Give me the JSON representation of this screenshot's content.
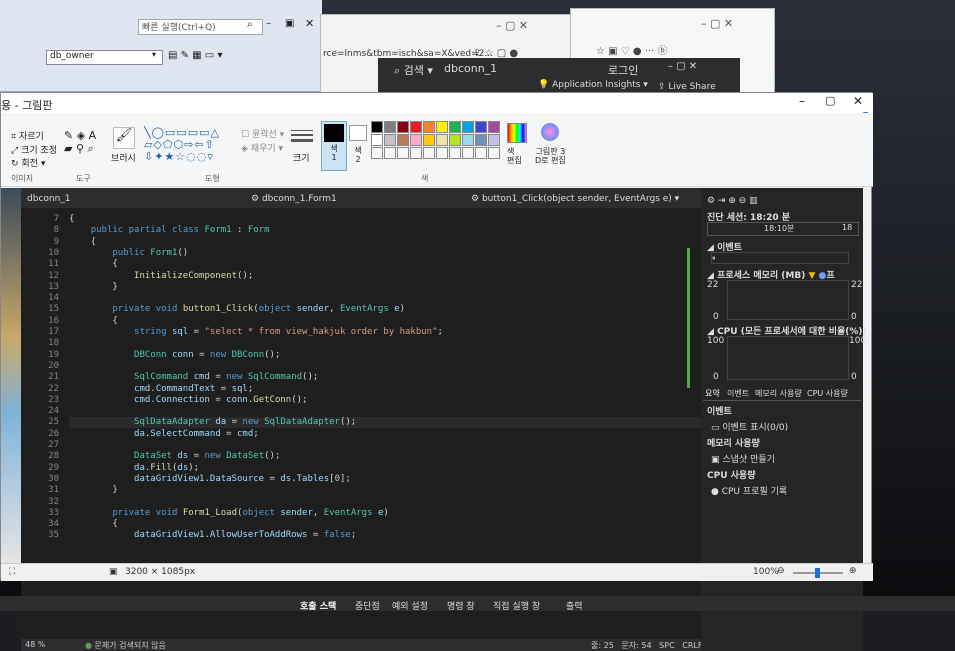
{
  "ssms": {
    "quick_launch_placeholder": "빠른 실행(Ctrl+Q)",
    "db_select": "db_owner"
  },
  "browser": {
    "url_fragment": "rce=lnms&tbm=isch&sa=X&ved=2...",
    "tab_label": "Application Insights"
  },
  "vs_dark_header": {
    "search_label": "검색",
    "project": "dbconn_1",
    "login": "로그인",
    "live_share": "Live Share"
  },
  "paint": {
    "title": "용 - 그림판",
    "ribbon": {
      "image_group": "이미지",
      "crop": "자르기",
      "resize": "크기 조정",
      "rotate": "회전",
      "tools_group": "도구",
      "brush": "브러시",
      "shapes_group": "도형",
      "outline": "윤곽선",
      "fill": "채우기",
      "size": "크기",
      "color1": "색\n1",
      "color2": "색\n2",
      "edit_colors": "색\n편집",
      "paint3d": "그림판 3\nD로 편집",
      "colors_group": "색"
    },
    "status": {
      "dimensions": "3200 × 1085px",
      "zoom": "100%"
    }
  },
  "vs": {
    "tab_project": "dbconn_1",
    "tab_class": "dbconn_1.Form1",
    "tab_member": "button1_Click(object sender, EventArgs e)",
    "zoom": "48 %",
    "status_issues": "문제가 검색되지 않음",
    "status_pos": "줄: 25   문자: 54   SPC   CRLF",
    "lines": [
      {
        "n": "7",
        "t": "{"
      },
      {
        "n": "8",
        "t": "    public partial class Form1 : Form"
      },
      {
        "n": "9",
        "t": "    {"
      },
      {
        "n": "10",
        "t": "        public Form1()"
      },
      {
        "n": "11",
        "t": "        {"
      },
      {
        "n": "12",
        "t": "            InitializeComponent();"
      },
      {
        "n": "13",
        "t": "        }"
      },
      {
        "n": "14",
        "t": ""
      },
      {
        "n": "15",
        "t": "        private void button1_Click(object sender, EventArgs e)"
      },
      {
        "n": "16",
        "t": "        {"
      },
      {
        "n": "17",
        "t": "            string sql = \"select * from view_hakjuk order by hakbun\";"
      },
      {
        "n": "18",
        "t": ""
      },
      {
        "n": "19",
        "t": "            DBConn conn = new DBConn();"
      },
      {
        "n": "20",
        "t": ""
      },
      {
        "n": "21",
        "t": "            SqlCommand cmd = new SqlCommand();"
      },
      {
        "n": "22",
        "t": "            cmd.CommandText = sql;"
      },
      {
        "n": "23",
        "t": "            cmd.Connection = conn.GetConn();"
      },
      {
        "n": "24",
        "t": ""
      },
      {
        "n": "25",
        "t": "            SqlDataAdapter da = new SqlDataAdapter();"
      },
      {
        "n": "26",
        "t": "            da.SelectCommand = cmd;"
      },
      {
        "n": "27",
        "t": ""
      },
      {
        "n": "28",
        "t": "            DataSet ds = new DataSet();"
      },
      {
        "n": "29",
        "t": "            da.Fill(ds);"
      },
      {
        "n": "30",
        "t": "            dataGridView1.DataSource = ds.Tables[0];"
      },
      {
        "n": "31",
        "t": "        }"
      },
      {
        "n": "32",
        "t": ""
      },
      {
        "n": "33",
        "t": "        private void Form1_Load(object sender, EventArgs e)"
      },
      {
        "n": "34",
        "t": "        {"
      },
      {
        "n": "35",
        "t": "            dataGridView1.AllowUserToAddRows = false;"
      }
    ]
  },
  "diagnostics": {
    "session": "진단 세션: 18:20 분",
    "timeline_mark": "18:10분",
    "timeline_end": "18",
    "events_header": "이벤트",
    "process_memory": "프로세스 메모리 (MB)",
    "mem_label_p": "프",
    "mem_top": "22",
    "mem_bottom": "0",
    "cpu_header": "CPU (모든 프로세서에 대한 비율(%))",
    "cpu_top": "100",
    "cpu_bottom": "0",
    "tabs": [
      "요약",
      "이벤트",
      "메모리 사용량",
      "CPU 사용량"
    ],
    "sec_events": "이벤트",
    "show_events": "이벤트 표시(0/0)",
    "sec_memory": "메모리 사용량",
    "snapshot": "스냅샷 만들기",
    "sec_cpu": "CPU 사용량",
    "cpu_profile": "CPU 프로필 기록"
  },
  "bottom_tabs": [
    "호출 스택",
    "중단점",
    "예외 설정",
    "명령 창",
    "직접 실행 창",
    "출력"
  ],
  "colors": {
    "palette": [
      "#000000",
      "#7f7f7f",
      "#880015",
      "#ed1c24",
      "#ff7f27",
      "#fff200",
      "#22b14c",
      "#00a2e8",
      "#3f48cc",
      "#a349a4",
      "#ffffff",
      "#c3c3c3",
      "#b97a57",
      "#ffaec9",
      "#ffc90e",
      "#efe4b0",
      "#b5e61d",
      "#99d9ea",
      "#7092be",
      "#c8bfe7"
    ]
  }
}
